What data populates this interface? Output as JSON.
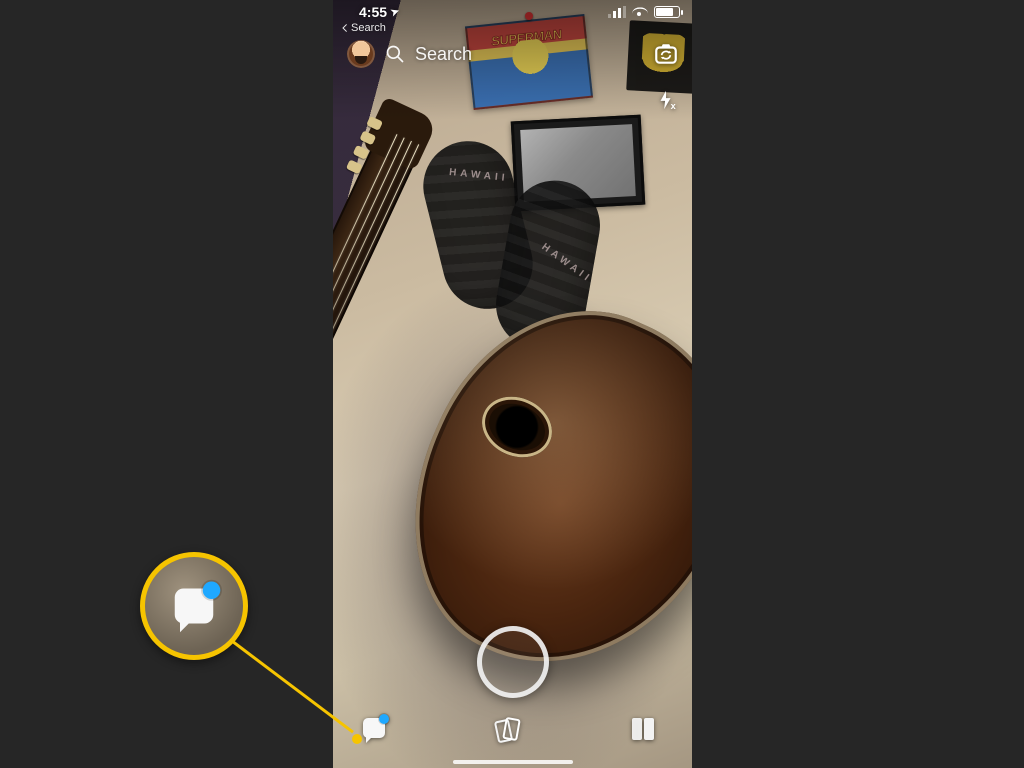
{
  "status_bar": {
    "time": "4:55",
    "location_arrow": "➤",
    "breadcrumb_back_label": "Search"
  },
  "search": {
    "placeholder": "Search",
    "icon_name": "search-icon"
  },
  "top_controls": {
    "flip_camera": "flip-camera-icon",
    "flash": "flash-off-icon",
    "flash_glyph": "✢"
  },
  "scene_text": {
    "poster_a_title": "SUPERMAN",
    "sock_word": "HAWAII"
  },
  "bottom_nav": {
    "chat": {
      "name": "chat-tab",
      "has_notification": true
    },
    "memories": {
      "name": "memories-tab"
    },
    "discover": {
      "name": "discover-tab"
    }
  },
  "capture": {
    "name": "capture-button"
  },
  "callout": {
    "highlight_target": "chat-tab",
    "accent_color": "#f6c400",
    "notification_color": "#1fa8ff"
  }
}
